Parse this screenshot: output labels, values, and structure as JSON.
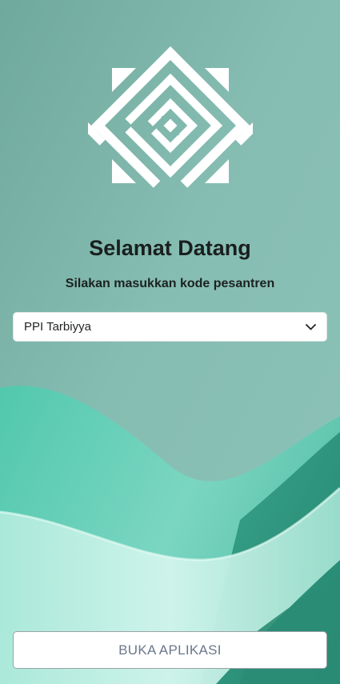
{
  "welcome": {
    "title": "Selamat Datang",
    "subtitle": "Silakan masukkan kode pesantren"
  },
  "pesantren_select": {
    "selected": "PPI Tarbiyya",
    "icon": "chevron-down-icon"
  },
  "open_button": {
    "label": "BUKA APLIKASI"
  },
  "colors": {
    "background_top": "#7fb8ac",
    "wave_teal": "#3fbfa4",
    "wave_light": "#bfeee2",
    "title_text": "#1a1f1e",
    "button_text": "#6b778c"
  },
  "logo": {
    "icon": "kufic-calligraphy-logo-icon"
  }
}
